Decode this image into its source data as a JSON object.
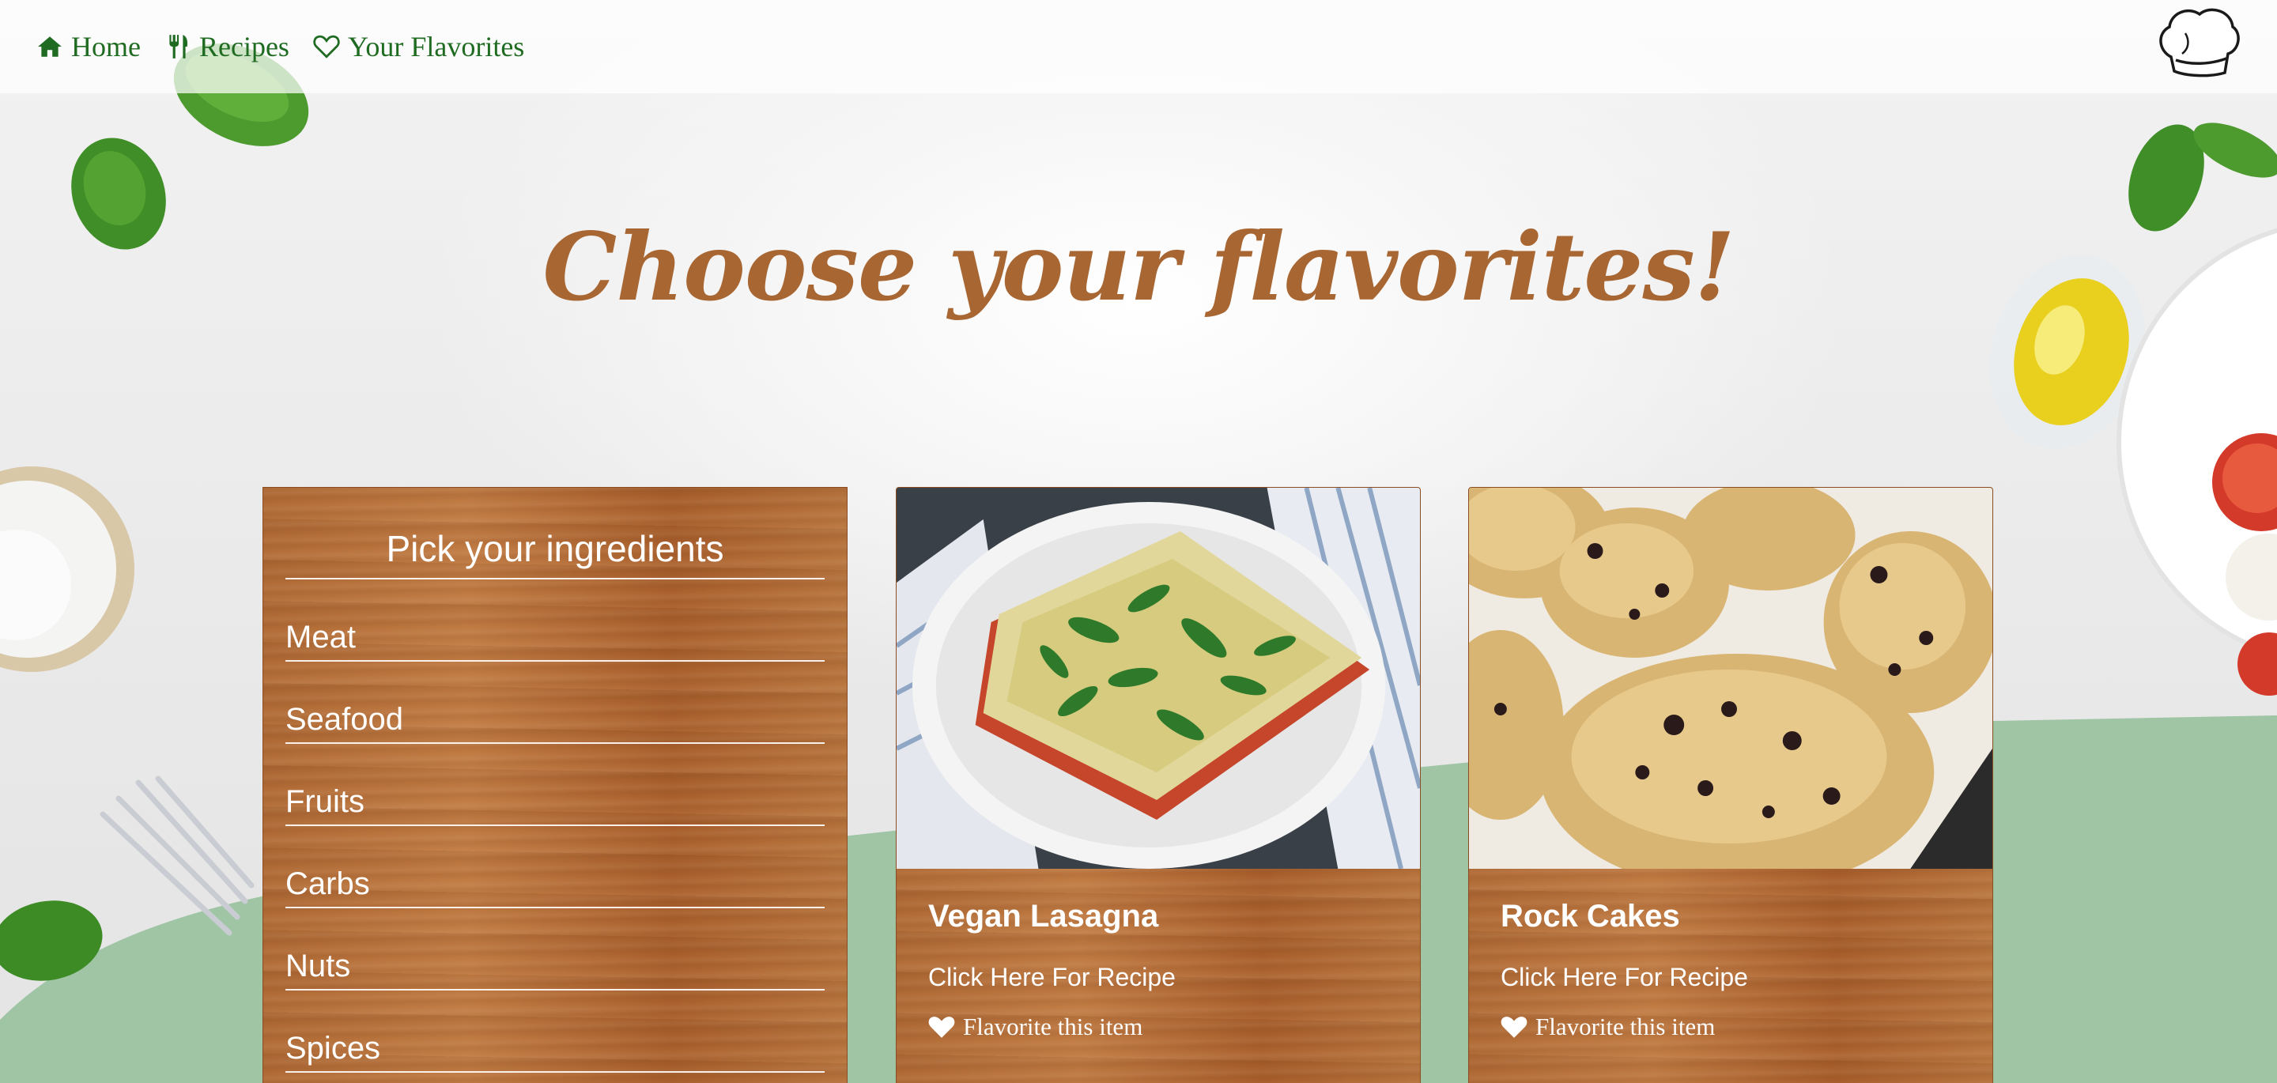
{
  "nav": {
    "items": [
      {
        "label": "Home",
        "icon": "home-icon"
      },
      {
        "label": "Recipes",
        "icon": "utensils-icon"
      },
      {
        "label": "Your Flavorites",
        "icon": "heart-outline-icon"
      }
    ],
    "logo_icon": "chef-hat-icon"
  },
  "hero": {
    "title": "Choose your flavorites!"
  },
  "ingredients": {
    "title": "Pick your ingredients",
    "items": [
      "Meat",
      "Seafood",
      "Fruits",
      "Carbs",
      "Nuts",
      "Spices"
    ]
  },
  "recipes": [
    {
      "name": "Vegan Lasagna",
      "link": "Click Here For Recipe",
      "favorite": "Flavorite this item",
      "image": "lasagna-photo"
    },
    {
      "name": "Rock Cakes",
      "link": "Click Here For Recipe",
      "favorite": "Flavorite this item",
      "image": "rock-cakes-photo"
    }
  ],
  "colors": {
    "nav_text": "#1f6b21",
    "title": "#a86632",
    "wood": "#b06a35",
    "green_wave": "#9fc5a5"
  }
}
